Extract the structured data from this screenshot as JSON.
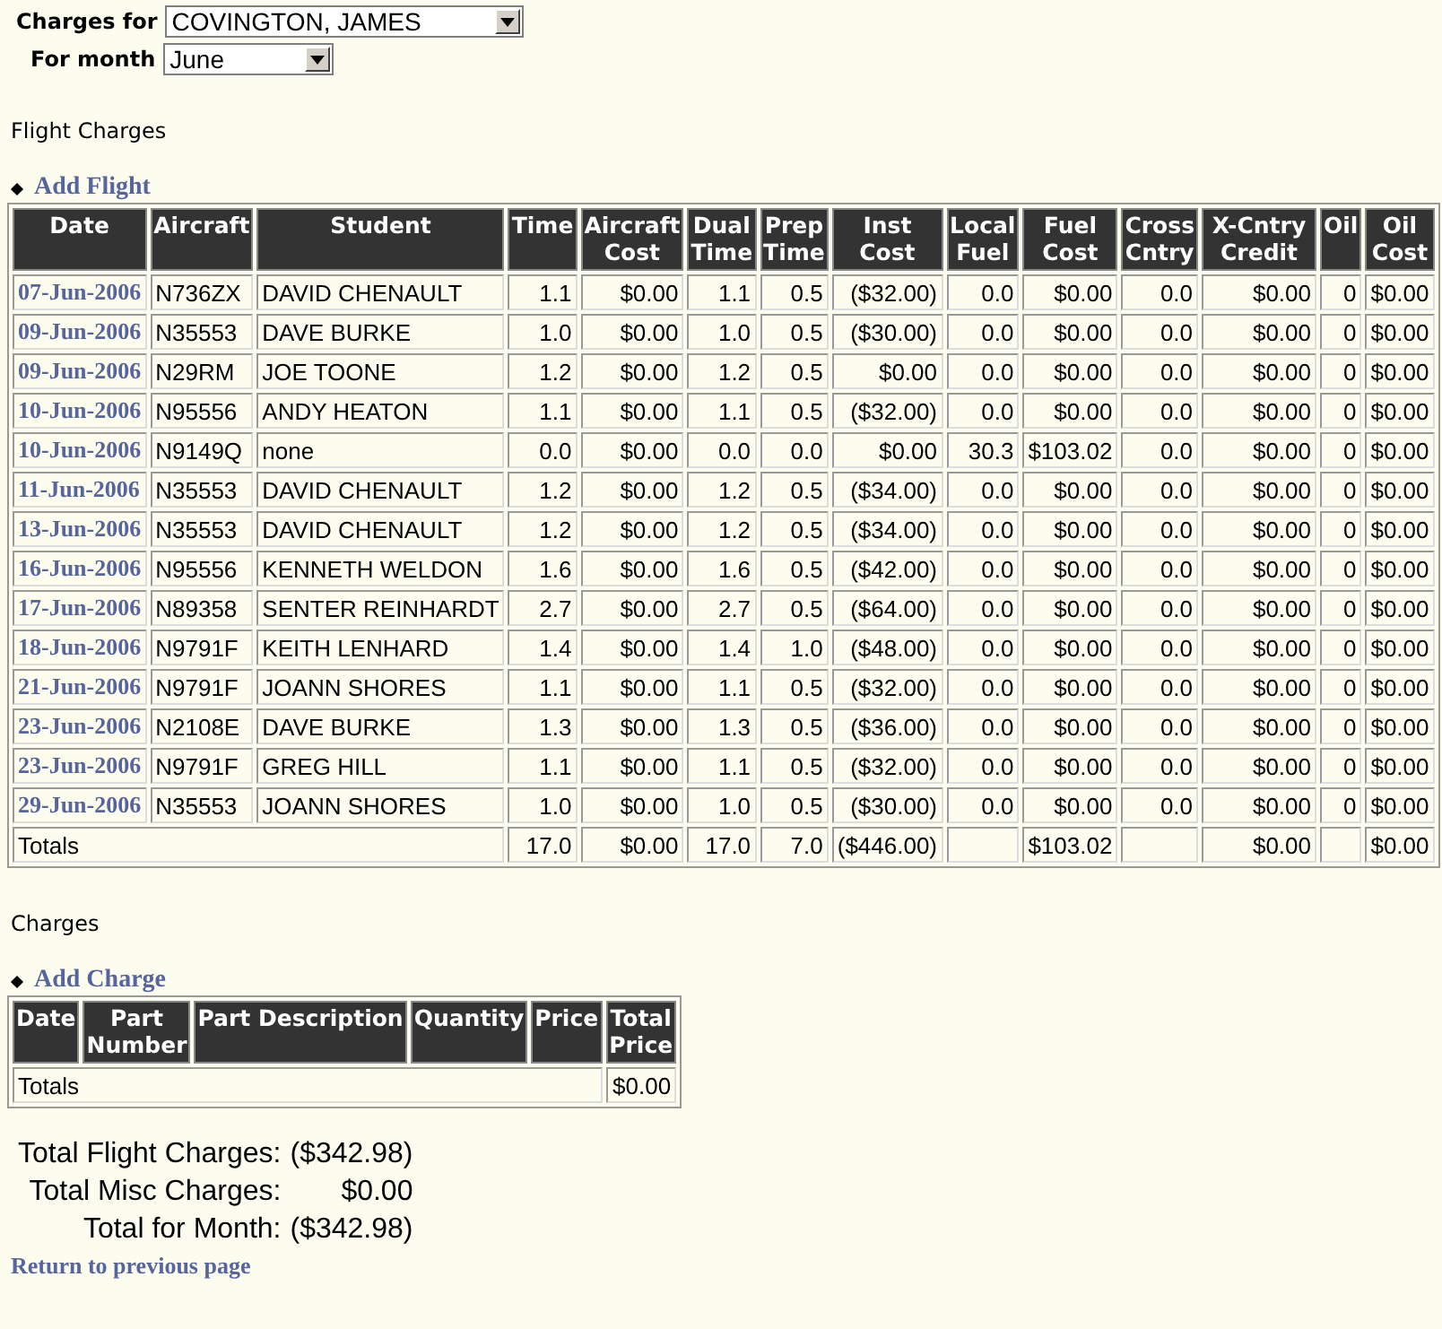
{
  "filters": [
    {
      "label": "Charges for",
      "value": "COVINGTON, JAMES",
      "kind": "wide"
    },
    {
      "label": "For month",
      "value": "June",
      "kind": "narrow"
    }
  ],
  "flight_section": {
    "title": "Flight Charges",
    "add_link": "Add Flight",
    "columns": [
      "Date",
      "Aircraft",
      "Student",
      "Time",
      "Aircraft Cost",
      "Dual Time",
      "Prep Time",
      "Inst Cost",
      "Local Fuel",
      "Fuel Cost",
      "Cross Cntry",
      "X-Cntry Credit",
      "Oil",
      "Oil Cost"
    ],
    "rows": [
      [
        "07-Jun-2006",
        "N736ZX",
        "DAVID CHENAULT",
        "1.1",
        "$0.00",
        "1.1",
        "0.5",
        "($32.00)",
        "0.0",
        "$0.00",
        "0.0",
        "$0.00",
        "0",
        "$0.00"
      ],
      [
        "09-Jun-2006",
        "N35553",
        "DAVE BURKE",
        "1.0",
        "$0.00",
        "1.0",
        "0.5",
        "($30.00)",
        "0.0",
        "$0.00",
        "0.0",
        "$0.00",
        "0",
        "$0.00"
      ],
      [
        "09-Jun-2006",
        "N29RM",
        "JOE TOONE",
        "1.2",
        "$0.00",
        "1.2",
        "0.5",
        "$0.00",
        "0.0",
        "$0.00",
        "0.0",
        "$0.00",
        "0",
        "$0.00"
      ],
      [
        "10-Jun-2006",
        "N95556",
        "ANDY HEATON",
        "1.1",
        "$0.00",
        "1.1",
        "0.5",
        "($32.00)",
        "0.0",
        "$0.00",
        "0.0",
        "$0.00",
        "0",
        "$0.00"
      ],
      [
        "10-Jun-2006",
        "N9149Q",
        "none",
        "0.0",
        "$0.00",
        "0.0",
        "0.0",
        "$0.00",
        "30.3",
        "$103.02",
        "0.0",
        "$0.00",
        "0",
        "$0.00"
      ],
      [
        "11-Jun-2006",
        "N35553",
        "DAVID CHENAULT",
        "1.2",
        "$0.00",
        "1.2",
        "0.5",
        "($34.00)",
        "0.0",
        "$0.00",
        "0.0",
        "$0.00",
        "0",
        "$0.00"
      ],
      [
        "13-Jun-2006",
        "N35553",
        "DAVID CHENAULT",
        "1.2",
        "$0.00",
        "1.2",
        "0.5",
        "($34.00)",
        "0.0",
        "$0.00",
        "0.0",
        "$0.00",
        "0",
        "$0.00"
      ],
      [
        "16-Jun-2006",
        "N95556",
        "KENNETH WELDON",
        "1.6",
        "$0.00",
        "1.6",
        "0.5",
        "($42.00)",
        "0.0",
        "$0.00",
        "0.0",
        "$0.00",
        "0",
        "$0.00"
      ],
      [
        "17-Jun-2006",
        "N89358",
        "SENTER REINHARDT",
        "2.7",
        "$0.00",
        "2.7",
        "0.5",
        "($64.00)",
        "0.0",
        "$0.00",
        "0.0",
        "$0.00",
        "0",
        "$0.00"
      ],
      [
        "18-Jun-2006",
        "N9791F",
        "KEITH LENHARD",
        "1.4",
        "$0.00",
        "1.4",
        "1.0",
        "($48.00)",
        "0.0",
        "$0.00",
        "0.0",
        "$0.00",
        "0",
        "$0.00"
      ],
      [
        "21-Jun-2006",
        "N9791F",
        "JOANN SHORES",
        "1.1",
        "$0.00",
        "1.1",
        "0.5",
        "($32.00)",
        "0.0",
        "$0.00",
        "0.0",
        "$0.00",
        "0",
        "$0.00"
      ],
      [
        "23-Jun-2006",
        "N2108E",
        "DAVE BURKE",
        "1.3",
        "$0.00",
        "1.3",
        "0.5",
        "($36.00)",
        "0.0",
        "$0.00",
        "0.0",
        "$0.00",
        "0",
        "$0.00"
      ],
      [
        "23-Jun-2006",
        "N9791F",
        "GREG HILL",
        "1.1",
        "$0.00",
        "1.1",
        "0.5",
        "($32.00)",
        "0.0",
        "$0.00",
        "0.0",
        "$0.00",
        "0",
        "$0.00"
      ],
      [
        "29-Jun-2006",
        "N35553",
        "JOANN SHORES",
        "1.0",
        "$0.00",
        "1.0",
        "0.5",
        "($30.00)",
        "0.0",
        "$0.00",
        "0.0",
        "$0.00",
        "0",
        "$0.00"
      ]
    ],
    "totals": {
      "label": "Totals",
      "time": "17.0",
      "aircraft_cost": "$0.00",
      "dual_time": "17.0",
      "prep_time": "7.0",
      "inst_cost": "($446.00)",
      "fuel_cost": "$103.02",
      "x_cntry_credit": "$0.00",
      "oil_cost": "$0.00"
    }
  },
  "charges_section": {
    "title": "Charges",
    "add_link": "Add Charge",
    "columns": [
      "Date",
      "Part Number",
      "Part Description",
      "Quantity",
      "Price",
      "Total Price"
    ],
    "totals": {
      "label": "Totals",
      "total_price": "$0.00"
    }
  },
  "summary": [
    {
      "label": "Total Flight Charges:",
      "value": "($342.98)"
    },
    {
      "label": "Total Misc Charges:",
      "value": "$0.00"
    },
    {
      "label": "Total for Month:",
      "value": "($342.98)"
    }
  ],
  "return_link": "Return to previous page"
}
